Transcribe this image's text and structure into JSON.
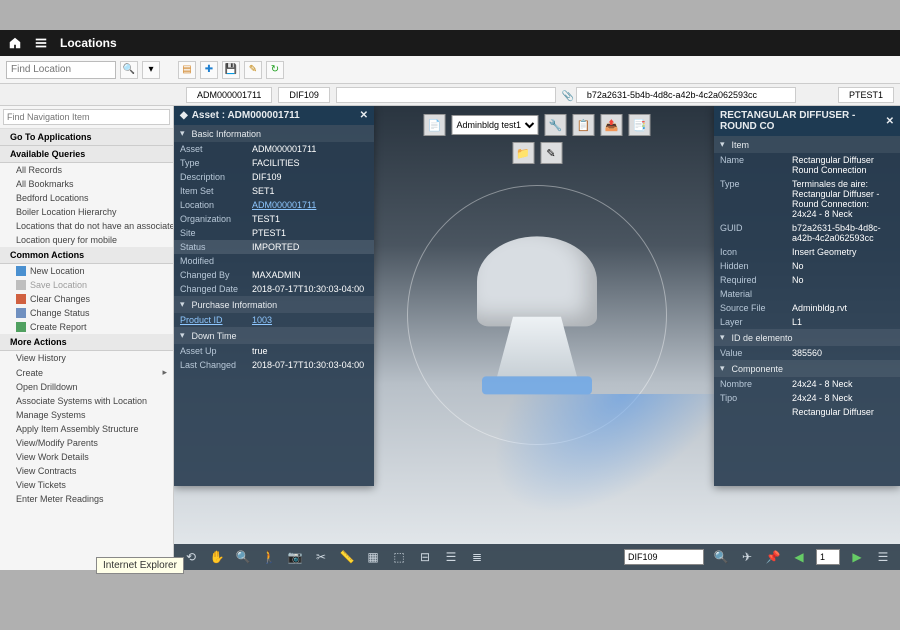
{
  "topbar": {
    "title": "Locations"
  },
  "toolbar": {
    "find_placeholder": "Find Location",
    "icons": [
      "search",
      "detail",
      "new",
      "save",
      "edit",
      "refresh"
    ]
  },
  "breadcrumbs": {
    "c1": "ADM000001711",
    "c2": "DIF109",
    "c3": "",
    "c4": "b72a2631-5b4b-4d8c-a42b-4c2a062593cc",
    "c5": "PTEST1"
  },
  "sidebar": {
    "nav_placeholder": "Find Navigation Item",
    "go_to_apps": "Go To Applications",
    "queries_head": "Available Queries",
    "queries": [
      "All Records",
      "All Bookmarks",
      "Bedford Locations",
      "Boiler Location Hierarchy",
      "Locations that do not have an associated...",
      "Location query for mobile"
    ],
    "common_head": "Common Actions",
    "common": [
      "New Location",
      "Save Location",
      "Clear Changes",
      "Change Status",
      "Create Report"
    ],
    "more_head": "More Actions",
    "more": [
      "View History",
      "Create",
      "Open Drilldown",
      "Associate Systems with Location",
      "Manage Systems",
      "Apply Item Assembly Structure",
      "View/Modify Parents",
      "View Work Details",
      "View Contracts",
      "View Tickets",
      "Enter Meter Readings"
    ]
  },
  "asset_panel": {
    "title": "Asset : ADM000001711",
    "sections": {
      "basic": "Basic Information",
      "purchase": "Purchase Information",
      "downtime": "Down Time"
    },
    "rows": {
      "asset_l": "Asset",
      "asset_v": "ADM000001711",
      "type_l": "Type",
      "type_v": "FACILITIES",
      "desc_l": "Description",
      "desc_v": "DIF109",
      "itemset_l": "Item Set",
      "itemset_v": "SET1",
      "loc_l": "Location",
      "loc_v": "ADM000001711",
      "org_l": "Organization",
      "org_v": "TEST1",
      "site_l": "Site",
      "site_v": "PTEST1",
      "status_l": "Status",
      "status_v": "IMPORTED",
      "mod_l": "Modified",
      "mod_v": "",
      "chby_l": "Changed By",
      "chby_v": "MAXADMIN",
      "chdate_l": "Changed Date",
      "chdate_v": "2018-07-17T10:30:03-04:00",
      "prod_l": "Product ID",
      "prod_v": "1003",
      "assetup_l": "Asset Up",
      "assetup_v": "true",
      "lastch_l": "Last Changed",
      "lastch_v": "2018-07-17T10:30:03-04:00"
    }
  },
  "right_panel": {
    "title": "RECTANGULAR DIFFUSER - ROUND CO",
    "sections": {
      "item": "Item",
      "idel": "ID de elemento",
      "comp": "Componente"
    },
    "rows": {
      "name_l": "Name",
      "name_v": "Rectangular Diffuser Round Connection",
      "type_l": "Type",
      "type_v": "Terminales de aire: Rectangular Diffuser - Round Connection: 24x24 - 8 Neck",
      "guid_l": "GUID",
      "guid_v": "b72a2631-5b4b-4d8c-a42b-4c2a062593cc",
      "icon_l": "Icon",
      "icon_v": "Insert Geometry",
      "hidden_l": "Hidden",
      "hidden_v": "No",
      "req_l": "Required",
      "req_v": "No",
      "mat_l": "Material",
      "mat_v": "",
      "src_l": "Source File",
      "src_v": "Adminbldg.rvt",
      "layer_l": "Layer",
      "layer_v": "L1",
      "value_l": "Value",
      "value_v": "385560",
      "nombre_l": "Nombre",
      "nombre_v": "24x24 - 8 Neck",
      "tipo_l": "Tipo",
      "tipo_v": "24x24 - 8 Neck",
      "fam_l": "",
      "fam_v": "Rectangular Diffuser"
    }
  },
  "float": {
    "dropdown": "Adminbldg test1"
  },
  "bottom": {
    "search_value": "DIF109",
    "page": "1"
  },
  "tooltip": "Internet Explorer"
}
